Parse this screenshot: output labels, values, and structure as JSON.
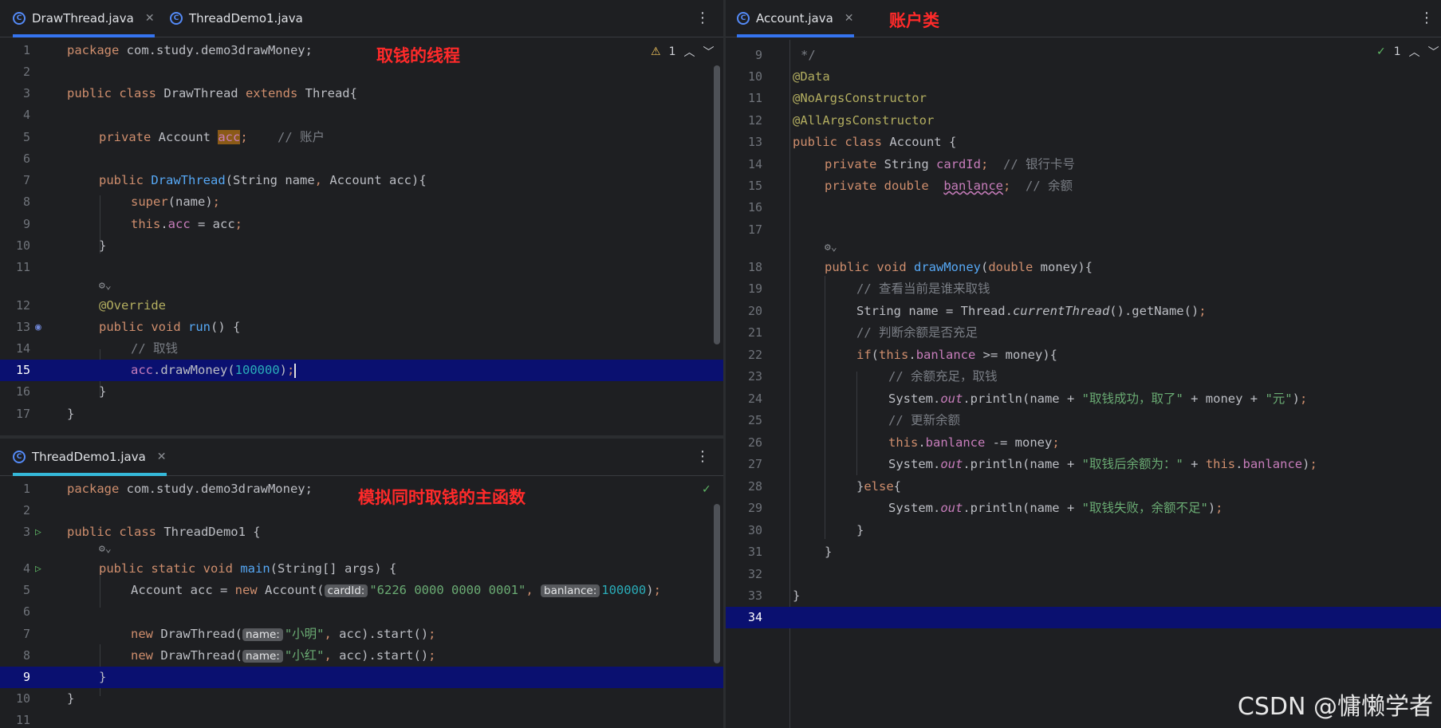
{
  "left_top": {
    "tabs": [
      {
        "label": "DrawThread.java",
        "active": true
      },
      {
        "label": "ThreadDemo1.java",
        "active": false
      }
    ],
    "annotation": "取钱的线程",
    "warning_count": "1"
  },
  "left_bottom": {
    "tabs": [
      {
        "label": "ThreadDemo1.java",
        "active": true
      }
    ],
    "annotation": "模拟同时取钱的主函数"
  },
  "right": {
    "tabs": [
      {
        "label": "Account.java",
        "active": true
      }
    ],
    "annotation": "账户类",
    "check_count": "1"
  },
  "watermark": "CSDN @慵懒学者",
  "colors": {
    "keyword": "#cf8e6d",
    "function": "#56a8f5",
    "number": "#2aacb8",
    "string": "#6aab73",
    "comment": "#7a7e85",
    "annotation": "#b3ae60",
    "field": "#c77dbb",
    "current_line": "#0a1070",
    "accent": "#3574f0"
  }
}
